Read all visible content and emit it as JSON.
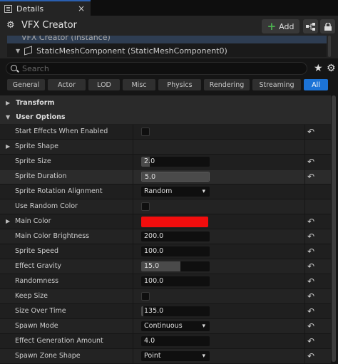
{
  "tab": {
    "title": "Details",
    "close": "×"
  },
  "header": {
    "icon": "vfx-actor-icon",
    "title": "VFX Creator",
    "add_label": "Add",
    "add_plus": "+"
  },
  "tree": {
    "selected": "VFX Creator (Instance)",
    "component": "StaticMeshComponent (StaticMeshComponent0)"
  },
  "search": {
    "placeholder": "Search"
  },
  "filters": [
    {
      "label": "General",
      "active": false
    },
    {
      "label": "Actor",
      "active": false
    },
    {
      "label": "LOD",
      "active": false
    },
    {
      "label": "Misc",
      "active": false
    },
    {
      "label": "Physics",
      "active": false
    },
    {
      "label": "Rendering",
      "active": false
    },
    {
      "label": "Streaming",
      "active": false
    },
    {
      "label": "All",
      "active": true
    }
  ],
  "categories": {
    "transform": "Transform",
    "user_options": "User Options"
  },
  "props": [
    {
      "label": "Start Effects When Enabled",
      "kind": "checkbox",
      "reset": true
    },
    {
      "label": "Sprite Shape",
      "kind": "expand",
      "reset": false
    },
    {
      "label": "Sprite Size",
      "kind": "number",
      "value": "2.0",
      "reset": true
    },
    {
      "label": "Sprite Duration",
      "kind": "number",
      "value": "5.0",
      "reset": true
    },
    {
      "label": "Sprite Rotation Alignment",
      "kind": "dropdown",
      "value": "Random",
      "reset": false
    },
    {
      "label": "Use Random Color",
      "kind": "checkbox",
      "reset": false
    },
    {
      "label": "Main Color",
      "kind": "color",
      "color": "#f20d0d",
      "reset": true
    },
    {
      "label": "Main Color Brightness",
      "kind": "number",
      "value": "200.0",
      "reset": true
    },
    {
      "label": "Sprite Speed",
      "kind": "number",
      "value": "100.0",
      "reset": true
    },
    {
      "label": "Effect Gravity",
      "kind": "number",
      "value": "15.0",
      "reset": true
    },
    {
      "label": "Randomness",
      "kind": "number",
      "value": "100.0",
      "reset": true
    },
    {
      "label": "Keep Size",
      "kind": "checkbox",
      "reset": true
    },
    {
      "label": "Size Over Time",
      "kind": "number",
      "value": "135.0",
      "reset": true
    },
    {
      "label": "Spawn Mode",
      "kind": "dropdown",
      "value": "Continuous",
      "reset": true
    },
    {
      "label": "Effect Generation Amount",
      "kind": "number",
      "value": "4.0",
      "reset": true
    },
    {
      "label": "Spawn Zone Shape",
      "kind": "dropdown",
      "value": "Point",
      "reset": true
    }
  ],
  "reset_glyph": "↶",
  "chevron": "⌄",
  "colors": {
    "accent": "#1c73d6",
    "main_color": "#f20d0d",
    "add_plus": "#4caf50"
  }
}
